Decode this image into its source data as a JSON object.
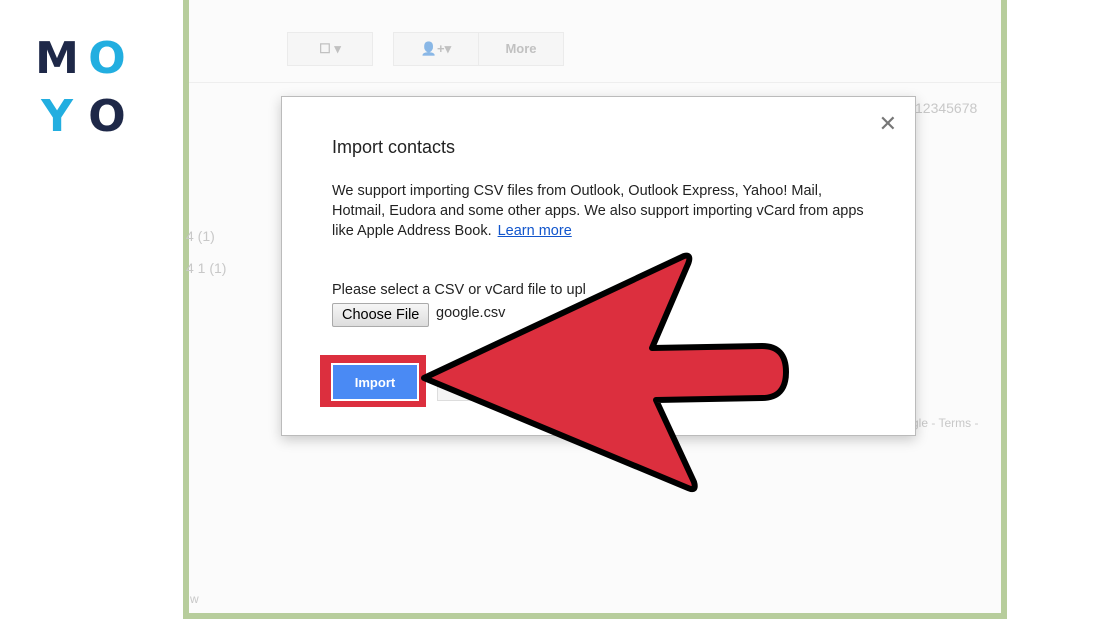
{
  "logo": {
    "letters": [
      "M",
      "O",
      "Y",
      "O"
    ],
    "colors": {
      "navy": "#1e2848",
      "cyan": "#22aee0"
    }
  },
  "toolbar": {
    "more_label": "More"
  },
  "background": {
    "phone": "12345678",
    "count1": "4 (1)",
    "count2": "4 1 (1)",
    "footer": "gle - Terms -",
    "corner": "w"
  },
  "dialog": {
    "title": "Import contacts",
    "description": "We support importing CSV files from Outlook, Outlook Express, Yahoo! Mail, Hotmail, Eudora and some other apps. We also support importing vCard from apps like Apple Address Book.",
    "learn_more": "Learn more",
    "select_prompt": "Please select a CSV or vCard file to upl",
    "choose_file": "Choose File",
    "file_name": "google.csv",
    "import": "Import",
    "close": "✕"
  },
  "colors": {
    "frame": "#b7cd9c",
    "arrow": "#dc2f3e",
    "button": "#4a8af4"
  }
}
